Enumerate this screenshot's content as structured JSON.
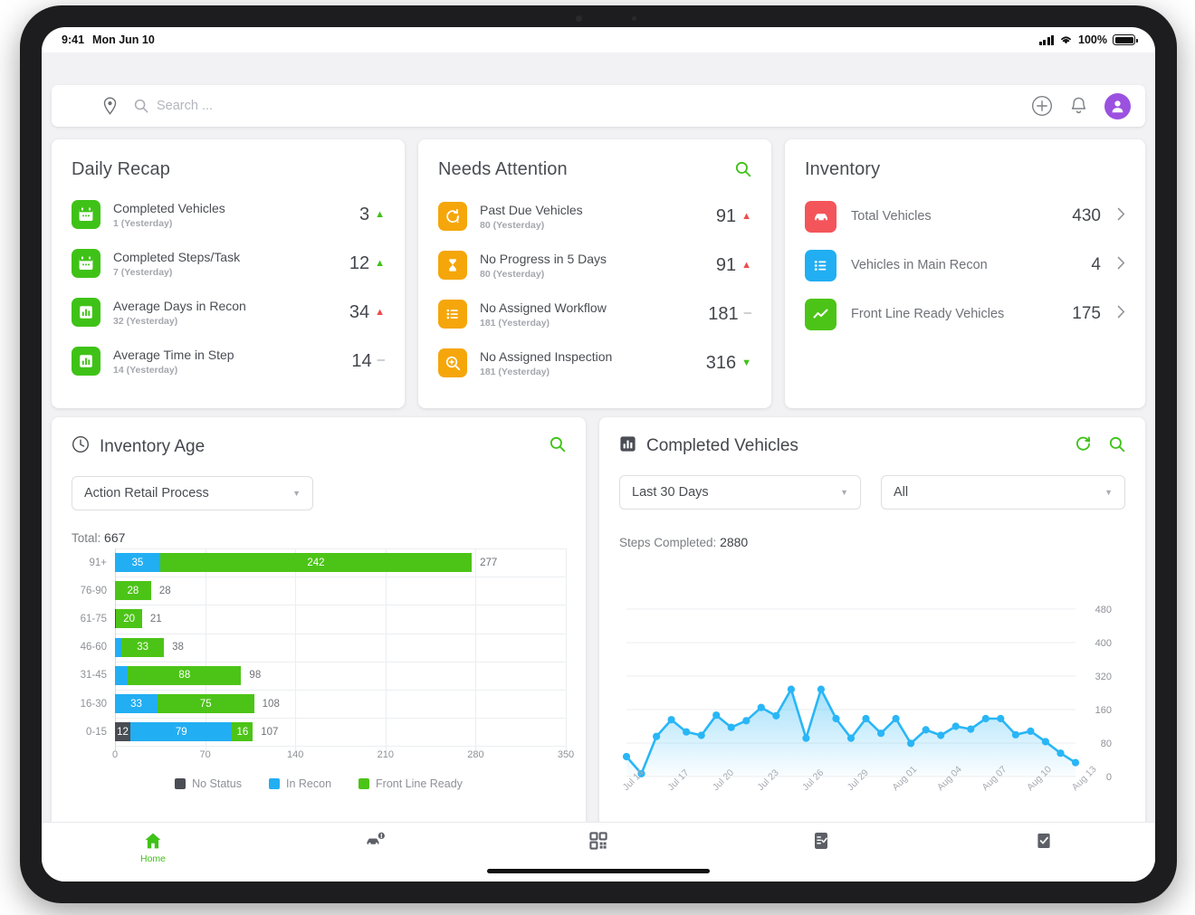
{
  "status_bar": {
    "time": "9:41",
    "date": "Mon Jun 10",
    "battery_percent": "100%",
    "signal_icon": "cellular-signal-icon",
    "wifi_icon": "wifi-icon",
    "battery_icon": "battery-icon"
  },
  "topbar": {
    "menu_icon": "hamburger-menu-icon",
    "location_icon": "location-pin-icon",
    "search_icon": "search-icon",
    "search_placeholder": "Search ...",
    "search_value": "",
    "add_icon": "plus-circle-icon",
    "notifications_icon": "bell-icon",
    "avatar_icon": "user-avatar-icon",
    "avatar_color": "#9b51e0"
  },
  "daily_recap": {
    "title": "Daily Recap",
    "items": [
      {
        "icon": "calendar-icon",
        "icon_color": "#3fc218",
        "label": "Completed Vehicles",
        "sub": "1 (Yesterday)",
        "value": "3",
        "trend": "up-green"
      },
      {
        "icon": "calendar-icon",
        "icon_color": "#3fc218",
        "label": "Completed Steps/Task",
        "sub": "7 (Yesterday)",
        "value": "12",
        "trend": "up-green"
      },
      {
        "icon": "bar-chart-icon",
        "icon_color": "#3fc218",
        "label": "Average Days in Recon",
        "sub": "32 (Yesterday)",
        "value": "34",
        "trend": "up-red"
      },
      {
        "icon": "bar-chart-icon",
        "icon_color": "#3fc218",
        "label": "Average Time in Step",
        "sub": "14 (Yesterday)",
        "value": "14",
        "trend": "flat"
      }
    ]
  },
  "needs_attention": {
    "title": "Needs Attention",
    "search_icon": "search-icon",
    "items": [
      {
        "icon": "clock-alert-icon",
        "icon_color": "#f5a60a",
        "label": "Past Due Vehicles",
        "sub": "80 (Yesterday)",
        "value": "91",
        "trend": "up-red"
      },
      {
        "icon": "hourglass-icon",
        "icon_color": "#f5a60a",
        "label": "No Progress in 5 Days",
        "sub": "80 (Yesterday)",
        "value": "91",
        "trend": "up-red"
      },
      {
        "icon": "list-icon",
        "icon_color": "#f5a60a",
        "label": "No Assigned Workflow",
        "sub": "181 (Yesterday)",
        "value": "181",
        "trend": "flat"
      },
      {
        "icon": "magnifier-plus-icon",
        "icon_color": "#f5a60a",
        "label": "No Assigned Inspection",
        "sub": "181 (Yesterday)",
        "value": "316",
        "trend": "down-green"
      }
    ]
  },
  "inventory": {
    "title": "Inventory",
    "items": [
      {
        "icon": "car-icon",
        "icon_color": "#f3555a",
        "label": "Total Vehicles",
        "value": "430",
        "chevron": "chevron-right-icon"
      },
      {
        "icon": "list-icon",
        "icon_color": "#22aef2",
        "label": "Vehicles in Main Recon",
        "value": "4",
        "chevron": "chevron-right-icon"
      },
      {
        "icon": "trend-line-icon",
        "icon_color": "#4cc417",
        "label": "Front Line Ready Vehicles",
        "value": "175",
        "chevron": "chevron-right-icon"
      }
    ]
  },
  "inventory_age": {
    "title": "Inventory Age",
    "title_icon": "clock-icon",
    "search_icon": "search-icon",
    "process_select": "Action Retail Process",
    "process_caret": "chevron-down-icon",
    "total_label": "Total:",
    "total_value": "667"
  },
  "completed_vehicles": {
    "title": "Completed Vehicles",
    "title_icon": "bar-chart-icon",
    "refresh_icon": "refresh-icon",
    "search_icon": "search-icon",
    "range_select": "Last 30 Days",
    "filter_select": "All",
    "caret": "chevron-down-icon",
    "steps_label": "Steps Completed:",
    "steps_value": "2880"
  },
  "bottom_nav": {
    "items": [
      {
        "icon": "home-icon",
        "label": "Home",
        "active": true
      },
      {
        "icon": "car-alert-icon",
        "label": "",
        "active": false
      },
      {
        "icon": "qr-code-icon",
        "label": "",
        "active": false
      },
      {
        "icon": "clipboard-check-icon",
        "label": "",
        "active": false
      },
      {
        "icon": "checkbox-check-icon",
        "label": "",
        "active": false
      }
    ]
  },
  "colors": {
    "no_status": "#4a4d53",
    "in_recon": "#22aef2",
    "front_line_ready": "#4cc417",
    "accent_green": "#3fc218",
    "accent_amber": "#f5a60a",
    "accent_red": "#f3555a",
    "line_blue": "#29b6f6"
  },
  "chart_data": [
    {
      "type": "bar",
      "orientation": "horizontal",
      "title": "Inventory Age",
      "subtitle": "Total: 667",
      "xlabel": "",
      "ylabel": "",
      "xlim": [
        0,
        350
      ],
      "xticks": [
        0,
        70,
        140,
        210,
        280,
        350
      ],
      "grid": true,
      "stacked": true,
      "legend": [
        "No Status",
        "In Recon",
        "Front Line Ready"
      ],
      "legend_colors": [
        "#4a4d53",
        "#22aef2",
        "#4cc417"
      ],
      "legend_position": "bottom",
      "categories": [
        "91+",
        "76-90",
        "61-75",
        "46-60",
        "31-45",
        "16-30",
        "0-15"
      ],
      "series": [
        {
          "name": "No Status",
          "values": [
            0,
            0,
            1,
            0,
            0,
            0,
            12
          ]
        },
        {
          "name": "In Recon",
          "values": [
            35,
            0,
            0,
            5,
            10,
            33,
            79
          ]
        },
        {
          "name": "Front Line Ready",
          "values": [
            242,
            28,
            20,
            33,
            88,
            75,
            16
          ]
        }
      ],
      "totals": [
        277,
        28,
        21,
        38,
        98,
        108,
        107
      ]
    },
    {
      "type": "area",
      "title": "Completed Vehicles",
      "subtitle": "Steps Completed: 2880",
      "xlabel": "",
      "ylabel": "",
      "ylim": [
        0,
        480
      ],
      "yticks": [
        0,
        80,
        160,
        320,
        400,
        480
      ],
      "grid": true,
      "legend_position": "none",
      "x": [
        "Jul 14",
        "Jul 15",
        "Jul 16",
        "Jul 17",
        "Jul 18",
        "Jul 19",
        "Jul 20",
        "Jul 21",
        "Jul 22",
        "Jul 23",
        "Jul 24",
        "Jul 25",
        "Jul 26",
        "Jul 27",
        "Jul 28",
        "Jul 29",
        "Jul 30",
        "Jul 31",
        "Aug 01",
        "Aug 02",
        "Aug 03",
        "Aug 04",
        "Aug 05",
        "Aug 06",
        "Aug 07",
        "Aug 08",
        "Aug 09",
        "Aug 10",
        "Aug 11",
        "Aug 12",
        "Aug 13"
      ],
      "xtick_labels": [
        "Jul 14",
        "Jul 17",
        "Jul 20",
        "Jul 23",
        "Jul 26",
        "Jul 29",
        "Aug 01",
        "Aug 04",
        "Aug 07",
        "Aug 10",
        "Aug 13"
      ],
      "series": [
        {
          "name": "Steps Completed",
          "color": "#29b6f6",
          "values": [
            57,
            8,
            115,
            163,
            128,
            118,
            176,
            141,
            160,
            198,
            174,
            250,
            110,
            250,
            166,
            110,
            166,
            124,
            166,
            95,
            134,
            118,
            144,
            136,
            166,
            166,
            120,
            130,
            100,
            67,
            40
          ]
        }
      ]
    }
  ]
}
